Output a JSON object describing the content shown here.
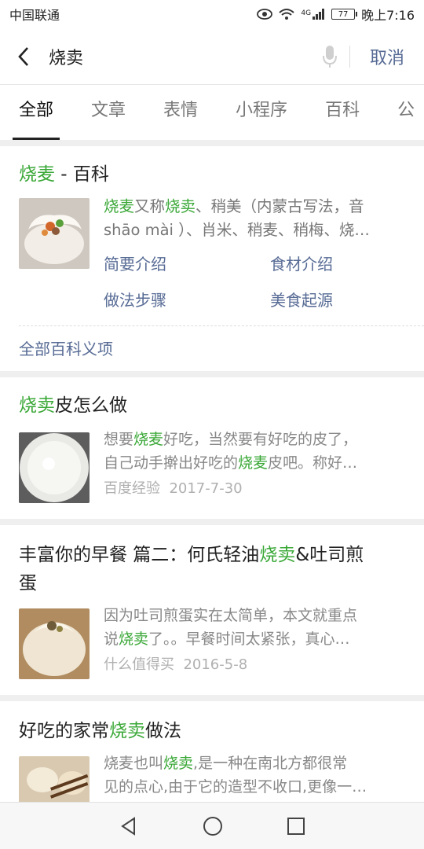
{
  "status_bar": {
    "carrier": "中国联通",
    "network": "4G",
    "battery": "77",
    "time": "晚上7:16"
  },
  "search": {
    "query": "烧卖",
    "cancel_label": "取消"
  },
  "tabs": [
    "全部",
    "文章",
    "表情",
    "小程序",
    "百科",
    "公"
  ],
  "baike": {
    "title_hl": "烧麦",
    "title_rest": " - 百科",
    "snippet_line1": [
      "烧麦",
      "又称",
      "烧卖",
      "、稍美（内蒙古写法，音"
    ],
    "snippet_line2": "shāo mài ）、肖米、稍麦、稍梅、烧…",
    "links": [
      "简要介绍",
      "食材介绍",
      "做法步骤",
      "美食起源"
    ],
    "all_label": "全部百科义项"
  },
  "results": [
    {
      "title_parts": [
        "烧卖",
        "皮怎么做"
      ],
      "snippet1": [
        "想要",
        "烧麦",
        "好吃，当然要有好吃的皮了，"
      ],
      "snippet2": [
        "自己动手擀出好吃的",
        "烧麦",
        "皮吧。称好…"
      ],
      "source": "百度经验",
      "date": "2017-7-30"
    },
    {
      "title_parts": [
        "丰富你的早餐 篇二：何氏轻油",
        "烧卖",
        "&吐司煎"
      ],
      "title_line2": "蛋",
      "snippet1": [
        "因为吐司煎蛋实在太简单，本文就重点"
      ],
      "snippet2": [
        "说",
        "烧卖",
        "了。。早餐时间太紧张，真心…"
      ],
      "source": "什么值得买",
      "date": "2016-5-8"
    },
    {
      "title_parts": [
        "好吃的家常",
        "烧卖",
        "做法"
      ],
      "snippet1": [
        "烧麦也叫",
        "烧卖",
        ",是一种在南北方都很常"
      ],
      "snippet2": [
        "见的点心,由于它的造型不收口,更像一…"
      ]
    }
  ]
}
